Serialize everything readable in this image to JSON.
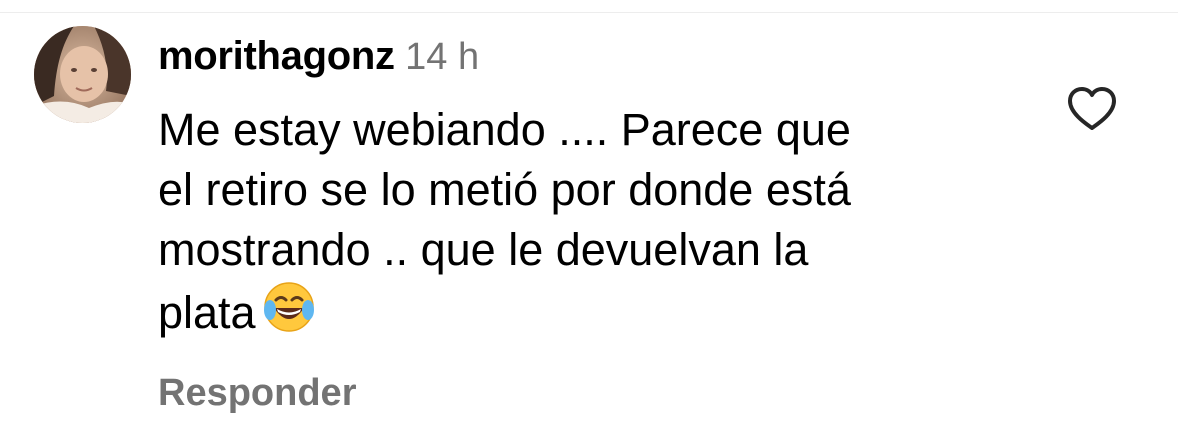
{
  "comment": {
    "username": "morithagonz",
    "timestamp": "14 h",
    "text_lines": [
      "Me estay webiando .... Parece que",
      "el retiro se lo metió por donde está",
      "mostrando .. que le devuelvan la",
      "plata"
    ],
    "emoji": "😂",
    "reply_label": "Responder",
    "like_icon": "heart-outline-icon",
    "avatar_icon": "user-avatar"
  },
  "colors": {
    "text": "#000000",
    "secondary_text": "#737373",
    "heart": "#262626"
  }
}
